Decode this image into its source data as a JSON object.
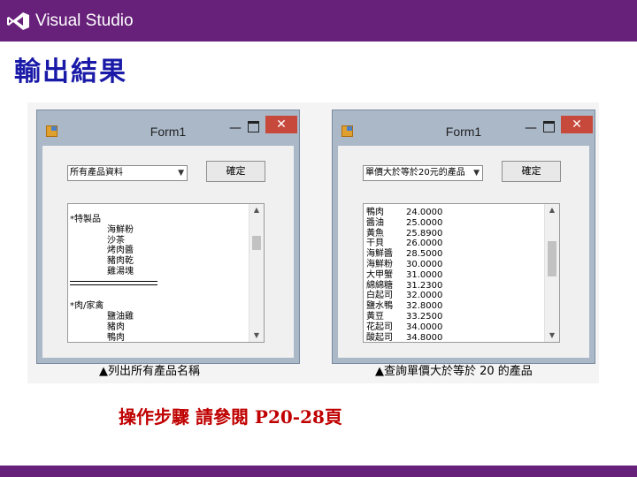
{
  "header": {
    "brand": "Visual Studio",
    "brand_color": "#68217a"
  },
  "slide": {
    "title": "輸出結果",
    "note": "操作步驟 請參閱  P20-28頁"
  },
  "left_window": {
    "title": "Form1",
    "combo_value": "所有產品資料",
    "ok_label": "確定",
    "list_items": [
      {
        "kind": "head",
        "text": "*特製品"
      },
      {
        "kind": "indent",
        "text": "海鮮粉"
      },
      {
        "kind": "indent",
        "text": "沙茶"
      },
      {
        "kind": "indent",
        "text": "烤肉醬"
      },
      {
        "kind": "indent",
        "text": "豬肉乾"
      },
      {
        "kind": "indent",
        "text": "雞湯塊"
      },
      {
        "kind": "sep",
        "text": ""
      },
      {
        "kind": "blank",
        "text": ""
      },
      {
        "kind": "head",
        "text": "*肉/家禽"
      },
      {
        "kind": "indent",
        "text": "鹽油雞"
      },
      {
        "kind": "indent",
        "text": "豬肉"
      },
      {
        "kind": "indent",
        "text": "鴨肉"
      }
    ],
    "caption": "▲列出所有產品名稱"
  },
  "right_window": {
    "title": "Form1",
    "combo_value": "單價大於等於20元的產品",
    "ok_label": "確定",
    "list_rows": [
      {
        "name": "鴨肉",
        "price": "24.0000"
      },
      {
        "name": "醬油",
        "price": "25.0000"
      },
      {
        "name": "黃魚",
        "price": "25.8900"
      },
      {
        "name": "干貝",
        "price": "26.0000"
      },
      {
        "name": "海鮮醬",
        "price": "28.5000"
      },
      {
        "name": "海鮮粉",
        "price": "30.0000"
      },
      {
        "name": "大甲蟹",
        "price": "31.0000"
      },
      {
        "name": "綿綿糖",
        "price": "31.2300"
      },
      {
        "name": "白起司",
        "price": "32.0000"
      },
      {
        "name": "鹽水鴨",
        "price": "32.8000"
      },
      {
        "name": "黃豆",
        "price": "33.2500"
      },
      {
        "name": "花起司",
        "price": "34.0000"
      },
      {
        "name": "酸起司",
        "price": "34.8000"
      }
    ],
    "caption": "▲查詢單價大於等於 20 的產品"
  },
  "icons": {
    "minimize": "minimize-icon",
    "maximize": "maximize-icon",
    "close": "close-icon",
    "dropdown": "chevron-down-icon",
    "app": "form-app-icon",
    "logo": "visual-studio-logo-icon"
  }
}
